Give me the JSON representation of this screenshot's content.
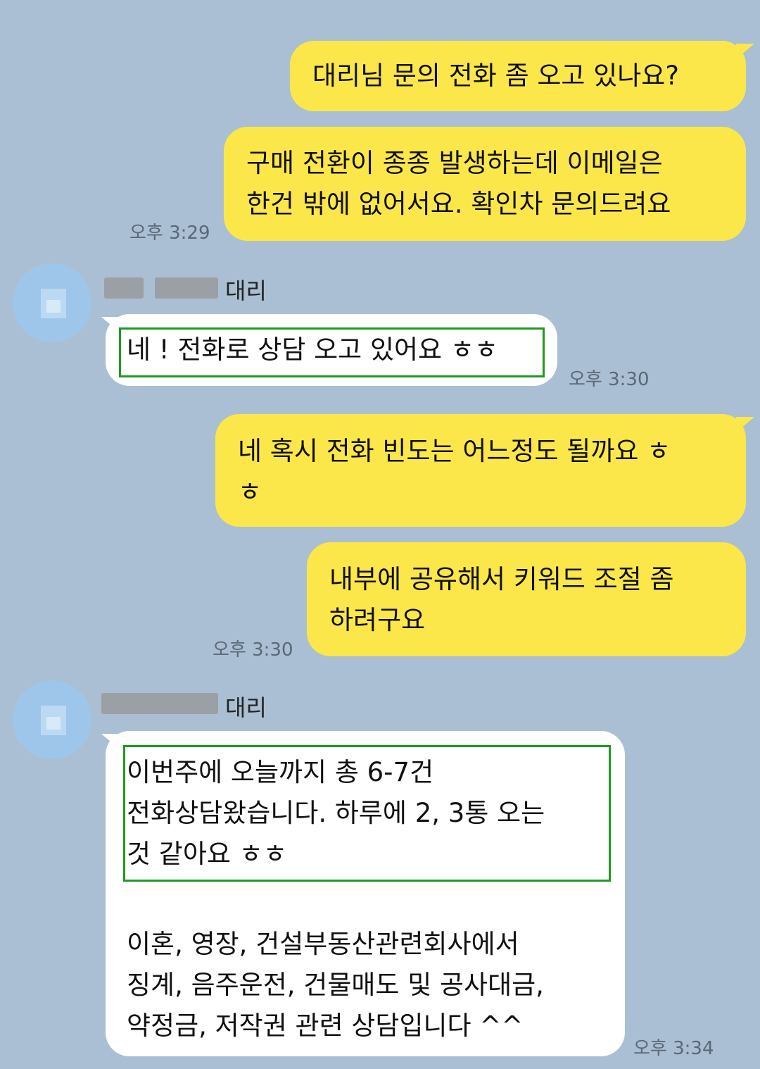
{
  "messages": [
    {
      "side": "me",
      "lines": [
        "대리님 문의 전화 좀 오고 있나요?"
      ]
    },
    {
      "side": "me",
      "lines": [
        "구매 전환이 종종 발생하는데 이메일은",
        "한건 밖에 없어서요. 확인차 문의드려요"
      ],
      "time": "오후 3:29"
    },
    {
      "side": "them",
      "sender_suffix": "대리",
      "lines": [
        "네 ! 전화로 상담 오고 있어요 ㅎㅎ"
      ],
      "time": "오후 3:30"
    },
    {
      "side": "me",
      "lines": [
        "네 혹시 전화 빈도는 어느정도 될까요 ㅎ",
        "ㅎ"
      ]
    },
    {
      "side": "me",
      "lines": [
        "내부에 공유해서 키워드 조절 좀",
        "하려구요"
      ],
      "time": "오후 3:30"
    },
    {
      "side": "them",
      "sender_suffix": "대리",
      "lines": [
        "이번주에 오늘까지 총 6-7건",
        "전화상담왔습니다. 하루에 2, 3통 오는",
        "것 같아요 ㅎㅎ",
        "",
        "이혼, 영장, 건설부동산관련회사에서",
        "징계, 음주운전, 건물매도 및 공사대금,",
        "약정금, 저작권 관련 상담입니다 ^^"
      ],
      "time": "오후 3:34"
    }
  ],
  "colors": {
    "background": "#aabfd3",
    "my_bubble": "#fbe74a",
    "their_bubble": "#ffffff",
    "highlight_box": "#1f9a1f"
  }
}
